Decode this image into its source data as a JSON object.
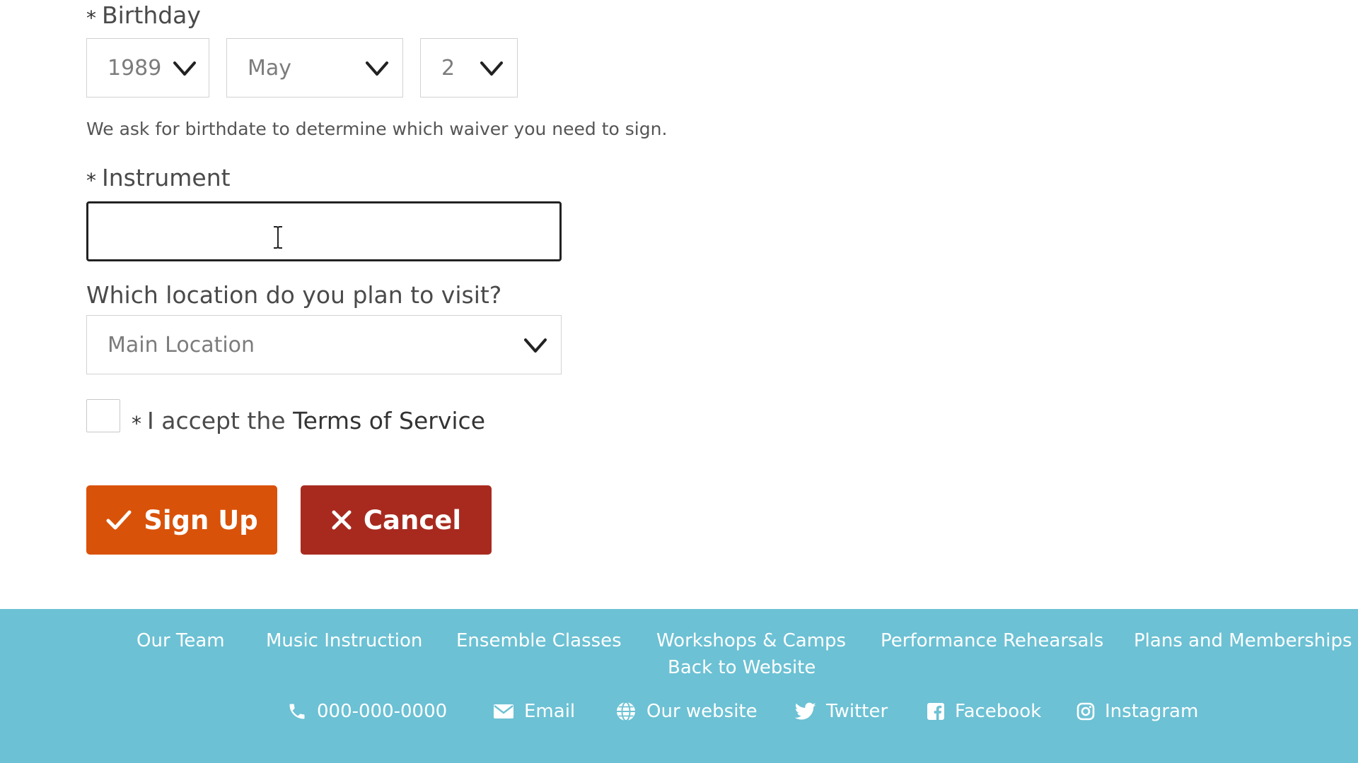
{
  "form": {
    "birthday": {
      "required_mark": "*",
      "label": "Birthday",
      "year": "1989",
      "month": "May",
      "day": "2",
      "help": "We ask for birthdate to determine which waiver you need to sign."
    },
    "instrument": {
      "required_mark": "*",
      "label": "Instrument",
      "value": ""
    },
    "location": {
      "label": "Which location do you plan to visit?",
      "selected": "Main Location"
    },
    "terms": {
      "required_mark": "*",
      "prefix": "I accept the",
      "link_text": "Terms of Service",
      "checked": false
    },
    "buttons": {
      "signup": "Sign Up",
      "cancel": "Cancel"
    }
  },
  "footer": {
    "nav": [
      "Our Team",
      "Music Instruction",
      "Ensemble Classes",
      "Workshops & Camps",
      "Performance Rehearsals",
      "Plans and Memberships"
    ],
    "back_link": "Back to Website",
    "contacts": [
      {
        "icon": "phone-icon",
        "label": "000-000-0000"
      },
      {
        "icon": "email-icon",
        "label": "Email"
      },
      {
        "icon": "globe-icon",
        "label": "Our website"
      },
      {
        "icon": "twitter-icon",
        "label": "Twitter"
      },
      {
        "icon": "facebook-icon",
        "label": "Facebook"
      },
      {
        "icon": "instagram-icon",
        "label": "Instagram"
      }
    ]
  },
  "colors": {
    "signup_button": "#d9520a",
    "cancel_button": "#a82a1f",
    "footer_background": "#6cc1d4"
  }
}
